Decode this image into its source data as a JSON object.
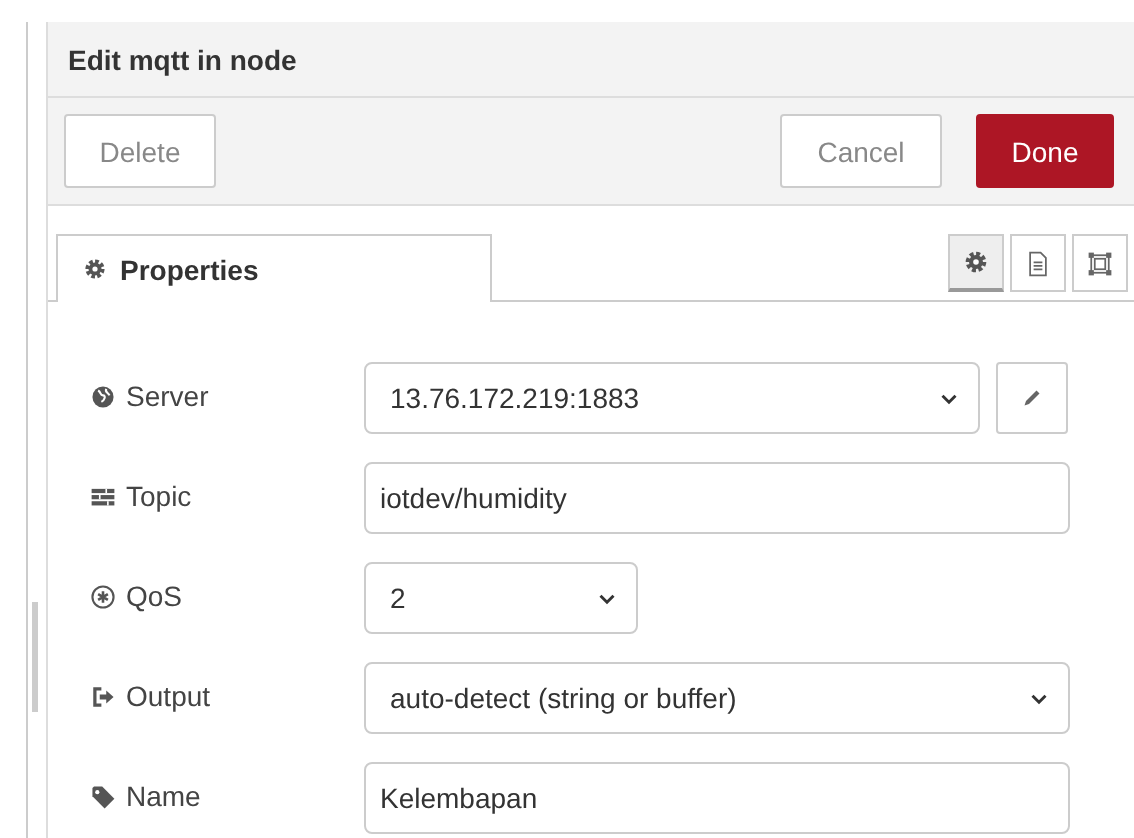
{
  "window": {
    "title": "Edit mqtt in node"
  },
  "toolbar": {
    "buttons": [
      {
        "label": "Delete",
        "kind": "plain"
      },
      {
        "label": "Cancel",
        "kind": "plain"
      },
      {
        "label": "Done",
        "kind": "primary"
      }
    ]
  },
  "tabs": [
    {
      "label": "Properties",
      "selected": true
    }
  ],
  "side_tabs": [
    {
      "selected": true
    },
    {
      "selected": false
    },
    {
      "selected": false
    }
  ],
  "fields": [
    {
      "label": "Server",
      "kind": "select",
      "value": "13.76.172.219:1883"
    },
    {
      "label": "Topic",
      "kind": "text",
      "value": "iotdev/humidity"
    },
    {
      "label": "QoS",
      "kind": "select",
      "value": "2"
    },
    {
      "label": "Output",
      "kind": "select",
      "value": "auto-detect (string or buffer)"
    },
    {
      "label": "Name",
      "kind": "text",
      "value": "Kelembapan"
    }
  ]
}
